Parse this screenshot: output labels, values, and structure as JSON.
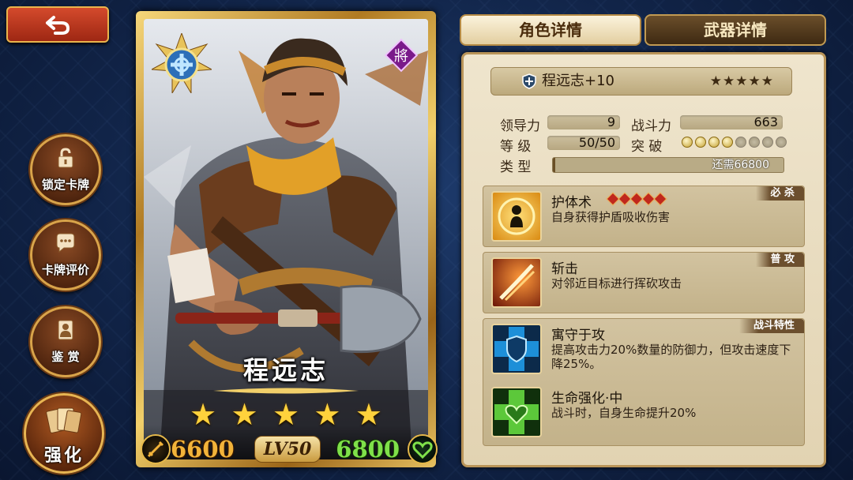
{
  "nav": {
    "back": "返回"
  },
  "menu": [
    {
      "label": "锁定卡牌",
      "icon": "lock-icon"
    },
    {
      "label": "卡牌评价",
      "icon": "chat-bubble-icon"
    },
    {
      "label": "鉴 赏",
      "icon": "portrait-card-icon"
    }
  ],
  "enhance": {
    "label": "强化",
    "icon": "cards-icon"
  },
  "card": {
    "name": "程远志",
    "stars": [
      "★",
      "★",
      "★",
      "★",
      "★"
    ],
    "attack": "6600",
    "level": "LV50",
    "hp": "6800",
    "rarity_glyph": "將"
  },
  "tabs": [
    {
      "label": "角色详情",
      "active": true
    },
    {
      "label": "武器详情",
      "active": false
    }
  ],
  "detail": {
    "name": "程远志+10",
    "stars": "★★★★★",
    "leadership_label": "领导力",
    "leadership_value": "9",
    "power_label": "战斗力",
    "power_value": "663",
    "level_label": "等 级",
    "level_value": "50/50",
    "breakthrough_label": "突 破",
    "breakthrough_filled": 4,
    "breakthrough_total": 8,
    "type_label": "类 型",
    "type_value": "还需66800"
  },
  "skills": [
    {
      "name": "护体术",
      "tag": "必 杀",
      "desc": "自身获得护盾吸收伤害",
      "icon": "shield-guard-skill-icon",
      "gems": 5
    },
    {
      "name": "斩击",
      "tag": "普 攻",
      "desc": "对邻近目标进行挥砍攻击",
      "icon": "slash-skill-icon",
      "gems": 0
    },
    {
      "name": "寓守于攻",
      "tag": "战斗特性",
      "desc": "提高攻击力20%数量的防御力，但攻击速度下降25%。",
      "icon": "blue-shield-cross-icon",
      "gems": 0
    },
    {
      "name": "生命强化·中",
      "tag": "",
      "desc": "战斗时，自身生命提升20%",
      "icon": "green-heart-cross-icon",
      "gems": 0
    }
  ],
  "colors": {
    "accent_gold": "#e9b44c",
    "attack": "#f2b33a",
    "hp": "#7fe04a",
    "panel": "#efe5cd"
  }
}
